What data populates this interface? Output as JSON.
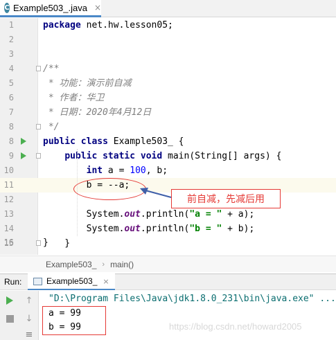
{
  "tab": {
    "icon": "java-class-icon",
    "icon_glyph": "C",
    "title": "Example503_.java",
    "close": "×"
  },
  "lines": {
    "n1": "1",
    "n2": "2",
    "n3": "3",
    "n4": "4",
    "n5": "5",
    "n6": "6",
    "n7": "7",
    "n8": "8",
    "n9": "9",
    "n10": "10",
    "n11": "11",
    "n12": "12",
    "n13": "13",
    "n14": "14",
    "n15": "15",
    "n16": "16"
  },
  "code": {
    "l1_kw": "package",
    "l1_rest": " net.hw.lesson05;",
    "l4": "/**",
    "l5": " * 功能：演示前自减",
    "l6": " * 作者：华卫",
    "l7": " * 日期：2020年4月12日",
    "l8": " */",
    "l8_kw": "public class",
    "l8_rest": " Example503_ {",
    "l9_indent": "    ",
    "l9_kw": "public static void",
    "l9_rest": " main(String[] args) {",
    "l10_indent": "        ",
    "l10_kw": "int",
    "l10_a": " a = ",
    "l10_num": "100",
    "l10_rest": ", b;",
    "l11": "        b = --a;",
    "l13_pre": "        System.",
    "l13_fld": "out",
    "l13_mid": ".println(",
    "l13_str": "\"a = \"",
    "l13_rest": " + a);",
    "l14_pre": "        System.",
    "l14_fld": "out",
    "l14_mid": ".println(",
    "l14_str": "\"b = \"",
    "l14_rest": " + b);",
    "l15": "    }",
    "l16": "}"
  },
  "annotation": {
    "text": "前自减，先减后用",
    "color": "#e53935"
  },
  "breadcrumb": {
    "class_name": "Example503_",
    "separator": "›",
    "method": "main()"
  },
  "run": {
    "label": "Run:",
    "tab": "Example503_",
    "close": "×",
    "command": "\"D:\\Program Files\\Java\\jdk1.8.0_231\\bin\\java.exe\" ...",
    "output": [
      "a = 99",
      "b = 99"
    ]
  },
  "watermark": "https://blog.csdn.net/howard2005",
  "colors": {
    "keyword": "#000080",
    "number": "#0000ff",
    "string": "#008000",
    "comment": "#808080",
    "accent": "#4a88c7"
  }
}
